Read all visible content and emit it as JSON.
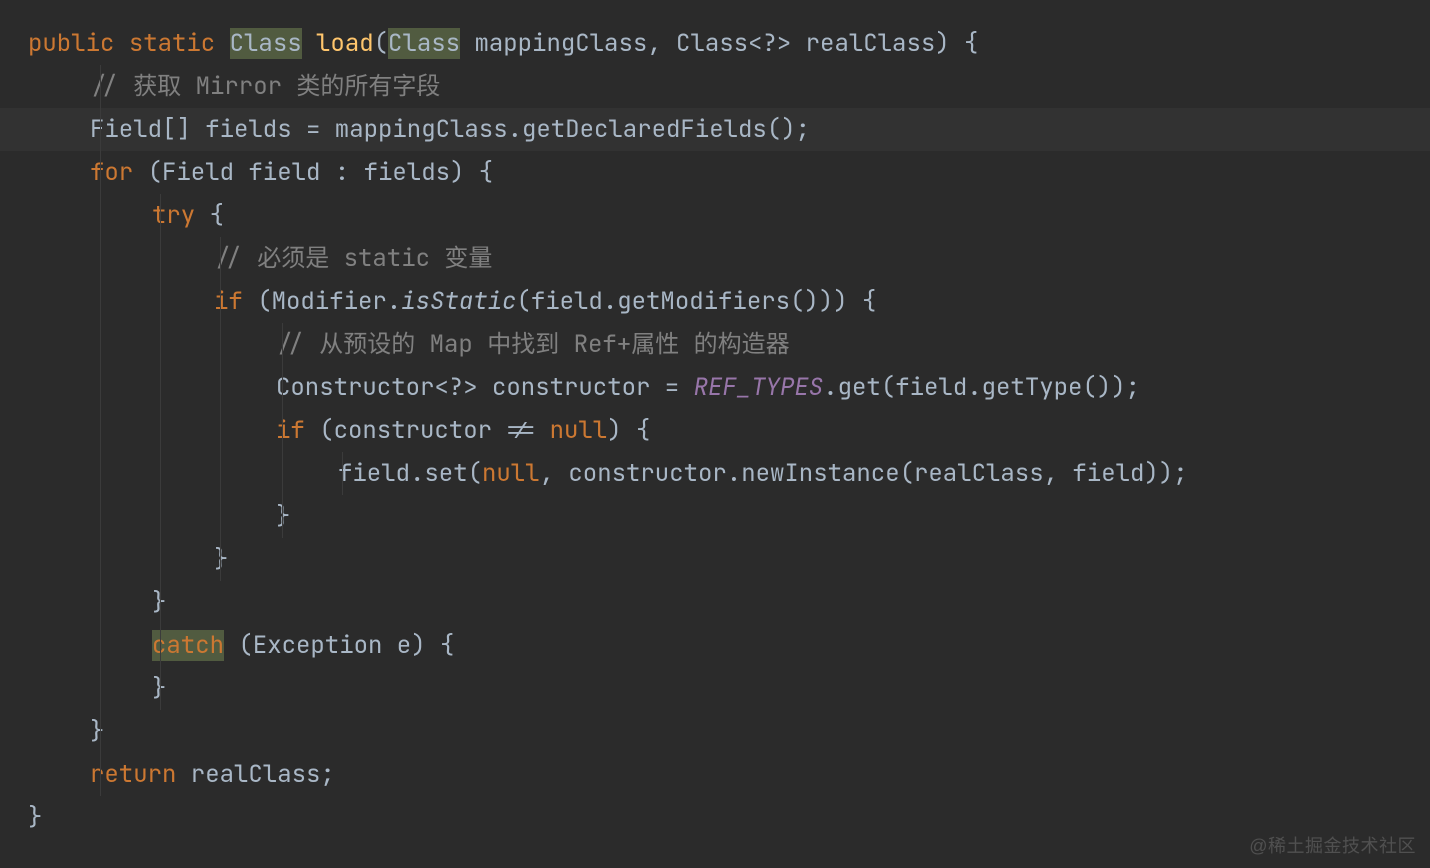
{
  "colors": {
    "background": "#2b2b2b",
    "current_line": "#323232",
    "text": "#a9b7c6",
    "keyword": "#cc7832",
    "method_name": "#ffc66d",
    "comment": "#808080",
    "static_field": "#9876aa",
    "highlight_bg": "#515b40"
  },
  "highlighted_tokens": [
    "Class",
    "Class",
    "catch"
  ],
  "current_line_index": 2,
  "watermark": "@稀土掘金技术社区",
  "code": {
    "lines": [
      {
        "indent": 0,
        "tokens": [
          {
            "t": "public",
            "c": "kw"
          },
          {
            "t": " ",
            "c": ""
          },
          {
            "t": "static",
            "c": "kw"
          },
          {
            "t": " ",
            "c": ""
          },
          {
            "t": "Class",
            "c": "hl"
          },
          {
            "t": " ",
            "c": ""
          },
          {
            "t": "load",
            "c": "methodnm"
          },
          {
            "t": "(",
            "c": "punct"
          },
          {
            "t": "Class",
            "c": "hl"
          },
          {
            "t": " mappingClass, Class<?> realClass) {",
            "c": "ident"
          }
        ]
      },
      {
        "indent": 1,
        "tokens": [
          {
            "t": "// 获取 Mirror 类的所有字段",
            "c": "comment"
          }
        ]
      },
      {
        "indent": 1,
        "tokens": [
          {
            "t": "Field[] fields = mappingClass.getDeclaredFields();",
            "c": "ident"
          }
        ]
      },
      {
        "indent": 1,
        "tokens": [
          {
            "t": "for",
            "c": "kw"
          },
          {
            "t": " (Field field : fields) {",
            "c": "ident"
          }
        ]
      },
      {
        "indent": 2,
        "tokens": [
          {
            "t": "try",
            "c": "kw"
          },
          {
            "t": " {",
            "c": "ident"
          }
        ]
      },
      {
        "indent": 3,
        "tokens": [
          {
            "t": "// 必须是 static 变量",
            "c": "comment"
          }
        ]
      },
      {
        "indent": 3,
        "tokens": [
          {
            "t": "if",
            "c": "kw"
          },
          {
            "t": " (Modifier.",
            "c": "ident"
          },
          {
            "t": "isStatic",
            "c": "methodit"
          },
          {
            "t": "(field.getModifiers())) {",
            "c": "ident"
          }
        ]
      },
      {
        "indent": 4,
        "tokens": [
          {
            "t": "// 从预设的 Map 中找到 Ref+属性 的构造器",
            "c": "comment"
          }
        ]
      },
      {
        "indent": 4,
        "tokens": [
          {
            "t": "Constructor<?> constructor = ",
            "c": "ident"
          },
          {
            "t": "REF_TYPES",
            "c": "staticit"
          },
          {
            "t": ".get(field.getType());",
            "c": "ident"
          }
        ]
      },
      {
        "indent": 4,
        "tokens": [
          {
            "t": "if",
            "c": "kw"
          },
          {
            "t": " (constructor != ",
            "c": "ident"
          },
          {
            "t": "null",
            "c": "kw"
          },
          {
            "t": ") {",
            "c": "ident"
          }
        ]
      },
      {
        "indent": 5,
        "tokens": [
          {
            "t": "field.set(",
            "c": "ident"
          },
          {
            "t": "null",
            "c": "kw"
          },
          {
            "t": ", constructor.newInstance(realClass, field));",
            "c": "ident"
          }
        ]
      },
      {
        "indent": 4,
        "tokens": [
          {
            "t": "}",
            "c": "ident"
          }
        ]
      },
      {
        "indent": 3,
        "tokens": [
          {
            "t": "}",
            "c": "ident"
          }
        ]
      },
      {
        "indent": 2,
        "tokens": [
          {
            "t": "}",
            "c": "ident"
          }
        ]
      },
      {
        "indent": 2,
        "tokens": [
          {
            "t": "catch",
            "c": "hl-kw"
          },
          {
            "t": " (Exception e) {",
            "c": "ident"
          }
        ]
      },
      {
        "indent": 2,
        "tokens": [
          {
            "t": "}",
            "c": "ident"
          }
        ]
      },
      {
        "indent": 1,
        "tokens": [
          {
            "t": "}",
            "c": "ident"
          }
        ]
      },
      {
        "indent": 1,
        "tokens": [
          {
            "t": "return",
            "c": "kw"
          },
          {
            "t": " realClass;",
            "c": "ident"
          }
        ]
      },
      {
        "indent": 0,
        "tokens": [
          {
            "t": "}",
            "c": "ident"
          }
        ]
      }
    ]
  }
}
